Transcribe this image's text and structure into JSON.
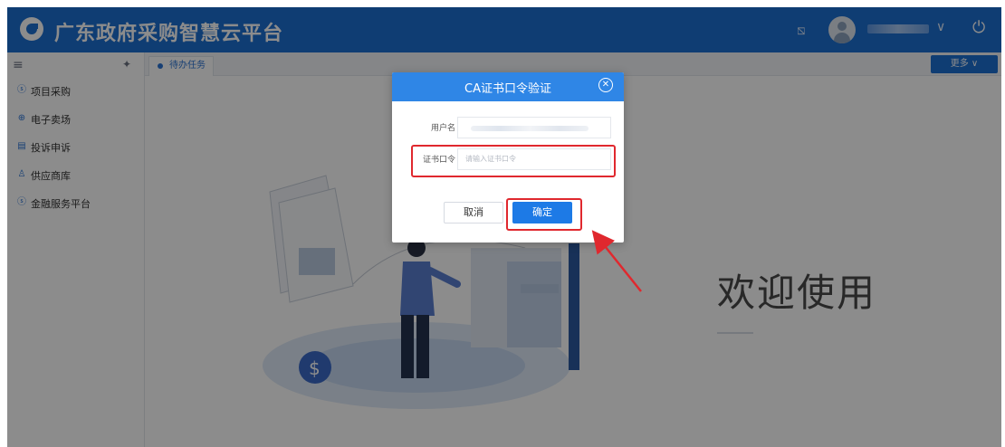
{
  "header": {
    "title": "广东政府采购智慧云平台",
    "icons": [
      "logo-icon",
      "screen-icon",
      "avatar-icon",
      "chevron-down-icon",
      "power-icon"
    ]
  },
  "sidebar": {
    "items": [
      {
        "label": "项目采购",
        "icon": "project-icon"
      },
      {
        "label": "电子卖场",
        "icon": "market-icon"
      },
      {
        "label": "投诉申诉",
        "icon": "complaint-icon"
      },
      {
        "label": "供应商库",
        "icon": "supplier-icon"
      },
      {
        "label": "金融服务平台",
        "icon": "finance-icon"
      }
    ]
  },
  "tabs": [
    {
      "label": "待办任务"
    }
  ],
  "more_label": "更多 ∨",
  "main": {
    "welcome": "欢迎使用"
  },
  "modal": {
    "title": "CA证书口令验证",
    "username_label": "用户名",
    "password_label": "证书口令",
    "password_placeholder": "请输入证书口令",
    "cancel_label": "取消",
    "confirm_label": "确定"
  },
  "colors": {
    "header": "#1d6fd1",
    "modal_header": "#2f86e6",
    "confirm": "#1d7ae6",
    "highlight": "#e0282e"
  }
}
